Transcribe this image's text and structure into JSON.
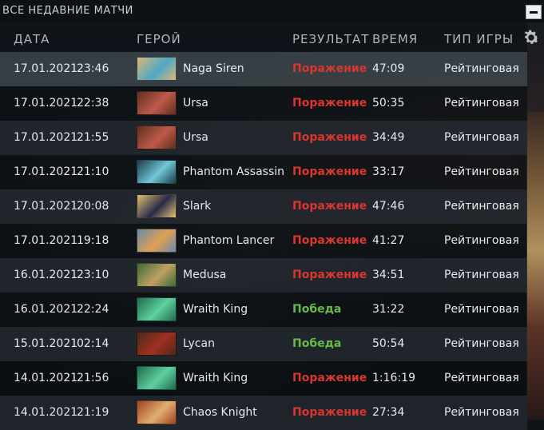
{
  "panel": {
    "title": "ВСЕ НЕДАВНИЕ МАТЧИ"
  },
  "columns": {
    "date": "ДАТА",
    "hero": "ГЕРОЙ",
    "result": "РЕЗУЛЬТАТ",
    "duration": "ВРЕМЯ",
    "game_type": "ТИП ИГРЫ"
  },
  "colors": {
    "loss": "#d9372d",
    "win": "#68b94a"
  },
  "matches": [
    {
      "date": "17.01.2021",
      "time": "23:46",
      "hero": "Naga Siren",
      "result": "Поражение",
      "outcome": "loss",
      "duration": "47:09",
      "type": "Рейтинговая",
      "portrait_colors": [
        "#d9b877",
        "#4fa8c7"
      ]
    },
    {
      "date": "17.01.2021",
      "time": "22:38",
      "hero": "Ursa",
      "result": "Поражение",
      "outcome": "loss",
      "duration": "50:35",
      "type": "Рейтинговая",
      "portrait_colors": [
        "#5a3020",
        "#c05a4a"
      ]
    },
    {
      "date": "17.01.2021",
      "time": "21:55",
      "hero": "Ursa",
      "result": "Поражение",
      "outcome": "loss",
      "duration": "34:49",
      "type": "Рейтинговая",
      "portrait_colors": [
        "#5a3020",
        "#c05a4a"
      ]
    },
    {
      "date": "17.01.2021",
      "time": "21:10",
      "hero": "Phantom Assassin",
      "result": "Поражение",
      "outcome": "loss",
      "duration": "33:17",
      "type": "Рейтинговая",
      "portrait_colors": [
        "#1e3a48",
        "#6fc8d8"
      ]
    },
    {
      "date": "17.01.2021",
      "time": "20:08",
      "hero": "Slark",
      "result": "Поражение",
      "outcome": "loss",
      "duration": "47:46",
      "type": "Рейтинговая",
      "portrait_colors": [
        "#e0c070",
        "#2a2a4a"
      ]
    },
    {
      "date": "17.01.2021",
      "time": "19:18",
      "hero": "Phantom Lancer",
      "result": "Поражение",
      "outcome": "loss",
      "duration": "41:27",
      "type": "Рейтинговая",
      "portrait_colors": [
        "#6a8ab0",
        "#e0a050"
      ]
    },
    {
      "date": "16.01.2021",
      "time": "23:10",
      "hero": "Medusa",
      "result": "Поражение",
      "outcome": "loss",
      "duration": "34:51",
      "type": "Рейтинговая",
      "portrait_colors": [
        "#3a6a3a",
        "#c0a060"
      ]
    },
    {
      "date": "16.01.2021",
      "time": "22:24",
      "hero": "Wraith King",
      "result": "Победа",
      "outcome": "win",
      "duration": "31:22",
      "type": "Рейтинговая",
      "portrait_colors": [
        "#1f6a4a",
        "#5fd0a0"
      ]
    },
    {
      "date": "15.01.2021",
      "time": "02:14",
      "hero": "Lycan",
      "result": "Победа",
      "outcome": "win",
      "duration": "50:54",
      "type": "Рейтинговая",
      "portrait_colors": [
        "#4a2a1a",
        "#a03020"
      ]
    },
    {
      "date": "14.01.2021",
      "time": "21:56",
      "hero": "Wraith King",
      "result": "Поражение",
      "outcome": "loss",
      "duration": "1:16:19",
      "type": "Рейтинговая",
      "portrait_colors": [
        "#1f6a4a",
        "#5fd0a0"
      ]
    },
    {
      "date": "14.01.2021",
      "time": "21:19",
      "hero": "Chaos Knight",
      "result": "Поражение",
      "outcome": "loss",
      "duration": "27:34",
      "type": "Рейтинговая",
      "portrait_colors": [
        "#a04020",
        "#e0b070"
      ]
    }
  ]
}
